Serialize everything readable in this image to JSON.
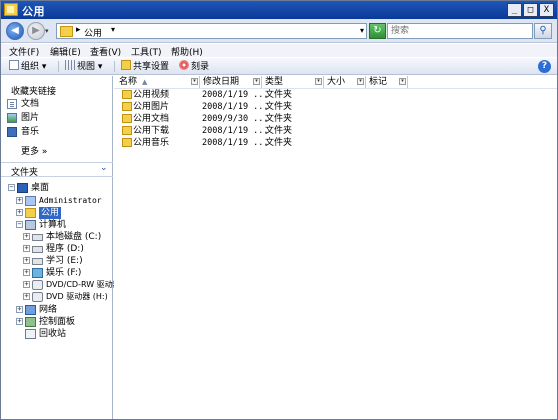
{
  "window": {
    "title": "公用",
    "min_label": "_",
    "max_label": "□",
    "close_label": "X"
  },
  "address": {
    "back_glyph": "◀",
    "fwd_glyph": "▶",
    "history_glyph": "▾",
    "separator": "▸",
    "crumb": "公用",
    "crumb_arrow": "▾",
    "dropdown_glyph": "▾",
    "refresh_glyph": "↻",
    "search_placeholder": "搜索",
    "search_glyph": "⚲"
  },
  "menubar": {
    "items": [
      "文件(F)",
      "编辑(E)",
      "查看(V)",
      "工具(T)",
      "帮助(H)"
    ]
  },
  "toolbar": {
    "organize": "组织 ▾",
    "views": "视图 ▾",
    "share": "共享设置",
    "burn": "刻录",
    "help_glyph": "?"
  },
  "favorites": {
    "title": "收藏夹链接",
    "items": [
      "文档",
      "图片",
      "音乐"
    ],
    "more": "更多  »"
  },
  "folders": {
    "title": "文件夹",
    "chevron": "⌄",
    "tree": [
      {
        "label": "桌面",
        "expander": "−"
      },
      {
        "label": "Administrator",
        "expander": "+"
      },
      {
        "label": "公用",
        "expander": "+"
      },
      {
        "label": "计算机",
        "expander": "−"
      },
      {
        "label": "本地磁盘 (C:)",
        "expander": "+"
      },
      {
        "label": "程序 (D:)",
        "expander": "+"
      },
      {
        "label": "学习 (E:)",
        "expander": "+"
      },
      {
        "label": "娱乐 (F:)",
        "expander": "+"
      },
      {
        "label": "DVD/CD-RW 驱动器",
        "expander": "+"
      },
      {
        "label": "DVD 驱动器 (H:)",
        "expander": "+"
      },
      {
        "label": "网络",
        "expander": "+"
      },
      {
        "label": "控制面板",
        "expander": "+"
      },
      {
        "label": "回收站",
        "expander": ""
      }
    ]
  },
  "filelist": {
    "columns": [
      "名称",
      "修改日期",
      "类型",
      "大小",
      "标记"
    ],
    "sort_glyph": "▲",
    "dd_glyph": "▾",
    "rows": [
      {
        "name": "公用视频",
        "date": "2008/1/19 ...",
        "type": "文件夹"
      },
      {
        "name": "公用图片",
        "date": "2008/1/19 ...",
        "type": "文件夹"
      },
      {
        "name": "公用文档",
        "date": "2009/9/30 ...",
        "type": "文件夹"
      },
      {
        "name": "公用下载",
        "date": "2008/1/19 ...",
        "type": "文件夹"
      },
      {
        "name": "公用音乐",
        "date": "2008/1/19 ...",
        "type": "文件夹"
      }
    ]
  }
}
